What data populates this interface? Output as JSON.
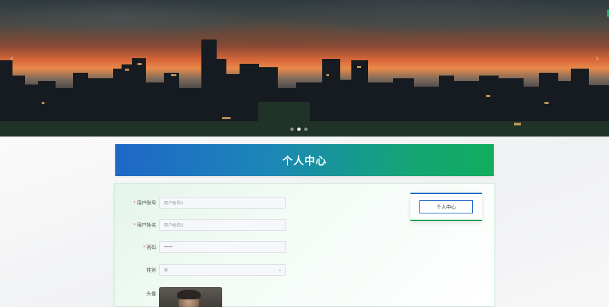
{
  "banner": {
    "prev_glyph": "‹",
    "next_glyph": "›",
    "dots_count": 3,
    "active_dot": 1
  },
  "page": {
    "title": "个人中心"
  },
  "form": {
    "account": {
      "label": "用户账号",
      "required_mark": "*",
      "placeholder": "用户账号8"
    },
    "name": {
      "label": "用户姓名",
      "required_mark": "*",
      "placeholder": "用户姓名8"
    },
    "password": {
      "label": "密码",
      "required_mark": "*",
      "value": "••••••"
    },
    "gender": {
      "label": "性别",
      "value": "男",
      "chevron": "⌄"
    },
    "avatar": {
      "label": "头像"
    }
  },
  "side_menu": {
    "items": [
      {
        "label": "个人中心"
      }
    ]
  },
  "colors": {
    "primary_blue": "#1f67c7",
    "primary_green": "#18a24f",
    "required_red": "#e53935"
  },
  "icons": {
    "prev": "chevron-left-icon",
    "next": "chevron-right-icon",
    "select": "chevron-down-icon"
  }
}
